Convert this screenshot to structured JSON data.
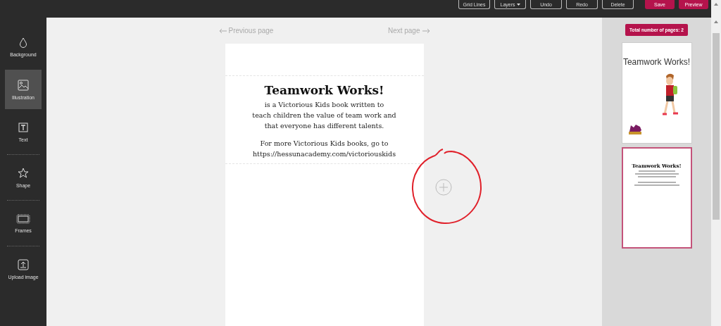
{
  "toolbar": {
    "buttons": [
      {
        "label": "Grid Lines",
        "kind": "outline"
      },
      {
        "label": "Layers",
        "kind": "dropdown"
      },
      {
        "label": "Undo",
        "kind": "outline"
      },
      {
        "label": "Redo",
        "kind": "outline"
      },
      {
        "label": "Delete",
        "kind": "outline"
      },
      {
        "label": "Save",
        "kind": "primary"
      },
      {
        "label": "Preview",
        "kind": "primary"
      }
    ]
  },
  "sidebar": {
    "items": [
      {
        "label": "Background",
        "selected": false
      },
      {
        "label": "Illustration",
        "selected": true
      },
      {
        "label": "Text",
        "selected": false
      },
      {
        "label": "Shape",
        "selected": false
      },
      {
        "label": "Frames",
        "selected": false
      },
      {
        "label": "Upload image",
        "selected": false
      }
    ]
  },
  "canvas": {
    "previous": "Previous page",
    "next": "Next page",
    "page": {
      "title": "Teamwork Works!",
      "lines": [
        "is a Victorious Kids book written to",
        "teach children the value of team work and",
        "that everyone has different talents."
      ],
      "more": [
        "For more Victorious Kids books, go to",
        "https://hessunacademy.com/victoriouskids"
      ]
    }
  },
  "pages_panel": {
    "total": "Total number of pages: 2",
    "thumbnails": [
      {
        "kind": "cover",
        "title": "Teamwork Works!",
        "selected": false
      },
      {
        "kind": "text",
        "title": "Teamwork Works!",
        "selected": true
      }
    ]
  }
}
